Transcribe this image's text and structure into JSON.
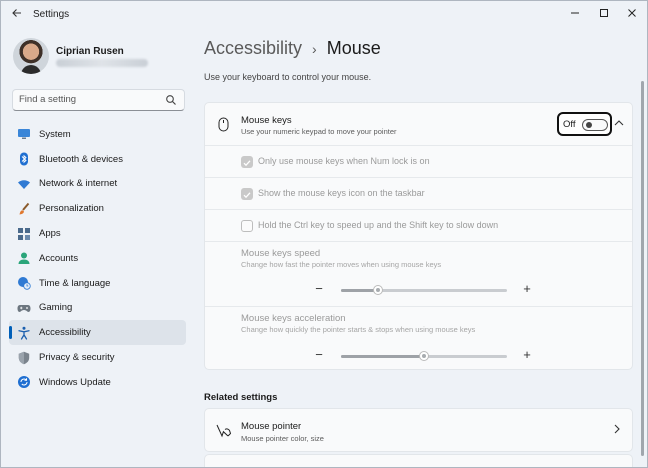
{
  "window": {
    "title": "Settings",
    "back_icon": "back-arrow-icon",
    "controls": {
      "minimize": "—",
      "maximize": "☐",
      "close": "✕"
    }
  },
  "profile": {
    "name": "Ciprian Rusen"
  },
  "search": {
    "placeholder": "Find a setting",
    "value": ""
  },
  "nav": {
    "items": [
      {
        "label": "System",
        "icon": "monitor-icon",
        "active": false
      },
      {
        "label": "Bluetooth & devices",
        "icon": "bluetooth-icon",
        "active": false
      },
      {
        "label": "Network & internet",
        "icon": "wifi-icon",
        "active": false
      },
      {
        "label": "Personalization",
        "icon": "paintbrush-icon",
        "active": false
      },
      {
        "label": "Apps",
        "icon": "apps-icon",
        "active": false
      },
      {
        "label": "Accounts",
        "icon": "person-icon",
        "active": false
      },
      {
        "label": "Time & language",
        "icon": "globe-clock-icon",
        "active": false
      },
      {
        "label": "Gaming",
        "icon": "gamepad-icon",
        "active": false
      },
      {
        "label": "Accessibility",
        "icon": "accessibility-icon",
        "active": true
      },
      {
        "label": "Privacy & security",
        "icon": "shield-icon",
        "active": false
      },
      {
        "label": "Windows Update",
        "icon": "refresh-icon",
        "active": false
      }
    ]
  },
  "page": {
    "breadcrumb_parent": "Accessibility",
    "breadcrumb_separator": "›",
    "title": "Mouse",
    "description": "Use your keyboard to control your mouse."
  },
  "mouse_keys": {
    "title": "Mouse keys",
    "subtitle": "Use your numeric keypad to move your pointer",
    "toggle_label": "Off",
    "toggle_on": false,
    "options": [
      {
        "label": "Only use mouse keys when Num lock is on",
        "checked": true
      },
      {
        "label": "Show the mouse keys icon on the taskbar",
        "checked": true
      },
      {
        "label": "Hold the Ctrl key to speed up and the Shift key to slow down",
        "checked": false
      }
    ],
    "speed": {
      "title": "Mouse keys speed",
      "subtitle": "Change how fast the pointer moves when using mouse keys",
      "minus": "−",
      "plus": "+",
      "value_fraction": 0.22
    },
    "acceleration": {
      "title": "Mouse keys acceleration",
      "subtitle": "Change how quickly the pointer starts & stops when using mouse keys",
      "minus": "−",
      "plus": "+",
      "value_fraction": 0.5
    }
  },
  "related": {
    "heading": "Related settings",
    "items": [
      {
        "title": "Mouse pointer",
        "subtitle": "Mouse pointer color, size",
        "icon": "mouse-pointer-icon"
      }
    ]
  },
  "colors": {
    "accent": "#005fb8",
    "background": "#eef2f7",
    "card": "#f9fafb"
  }
}
